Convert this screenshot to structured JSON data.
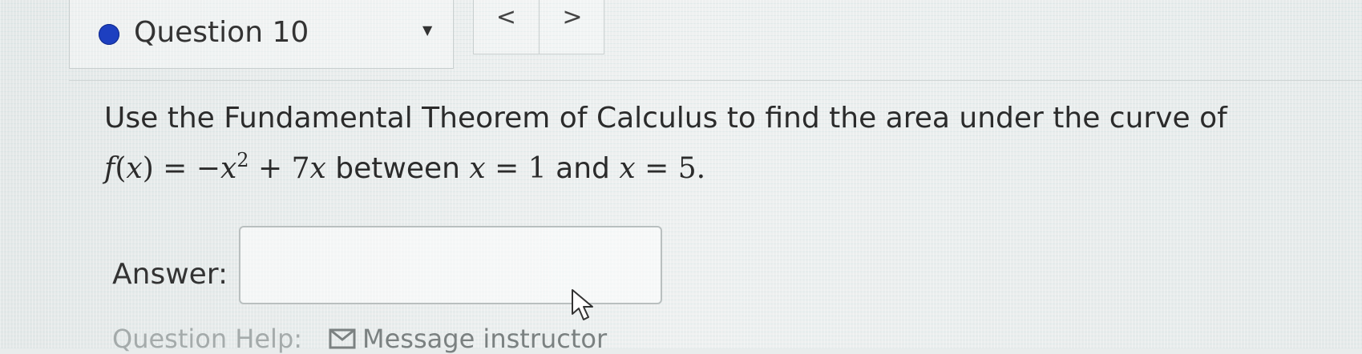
{
  "header": {
    "question_title": "Question 10",
    "status_color": "#1d3fc0",
    "dropdown_icon": "caret-down-icon",
    "prev_label": "<",
    "next_label": ">"
  },
  "question": {
    "line1": "Use the Fundamental Theorem of Calculus to find the area under the curve of",
    "f": "f",
    "x_var": "x",
    "lparen": "(",
    "rparen": ")",
    "equals": " = ",
    "minus": "−",
    "exponent": "2",
    "plus": " + ",
    "coef": "7",
    "between": "between",
    "eq_lower": " = 1",
    "and": "and",
    "eq_upper": " = 5."
  },
  "answer": {
    "label": "Answer:",
    "value": "",
    "placeholder": ""
  },
  "help": {
    "label": "Question Help:",
    "message_label": "Message instructor",
    "message_icon": "envelope-icon"
  }
}
